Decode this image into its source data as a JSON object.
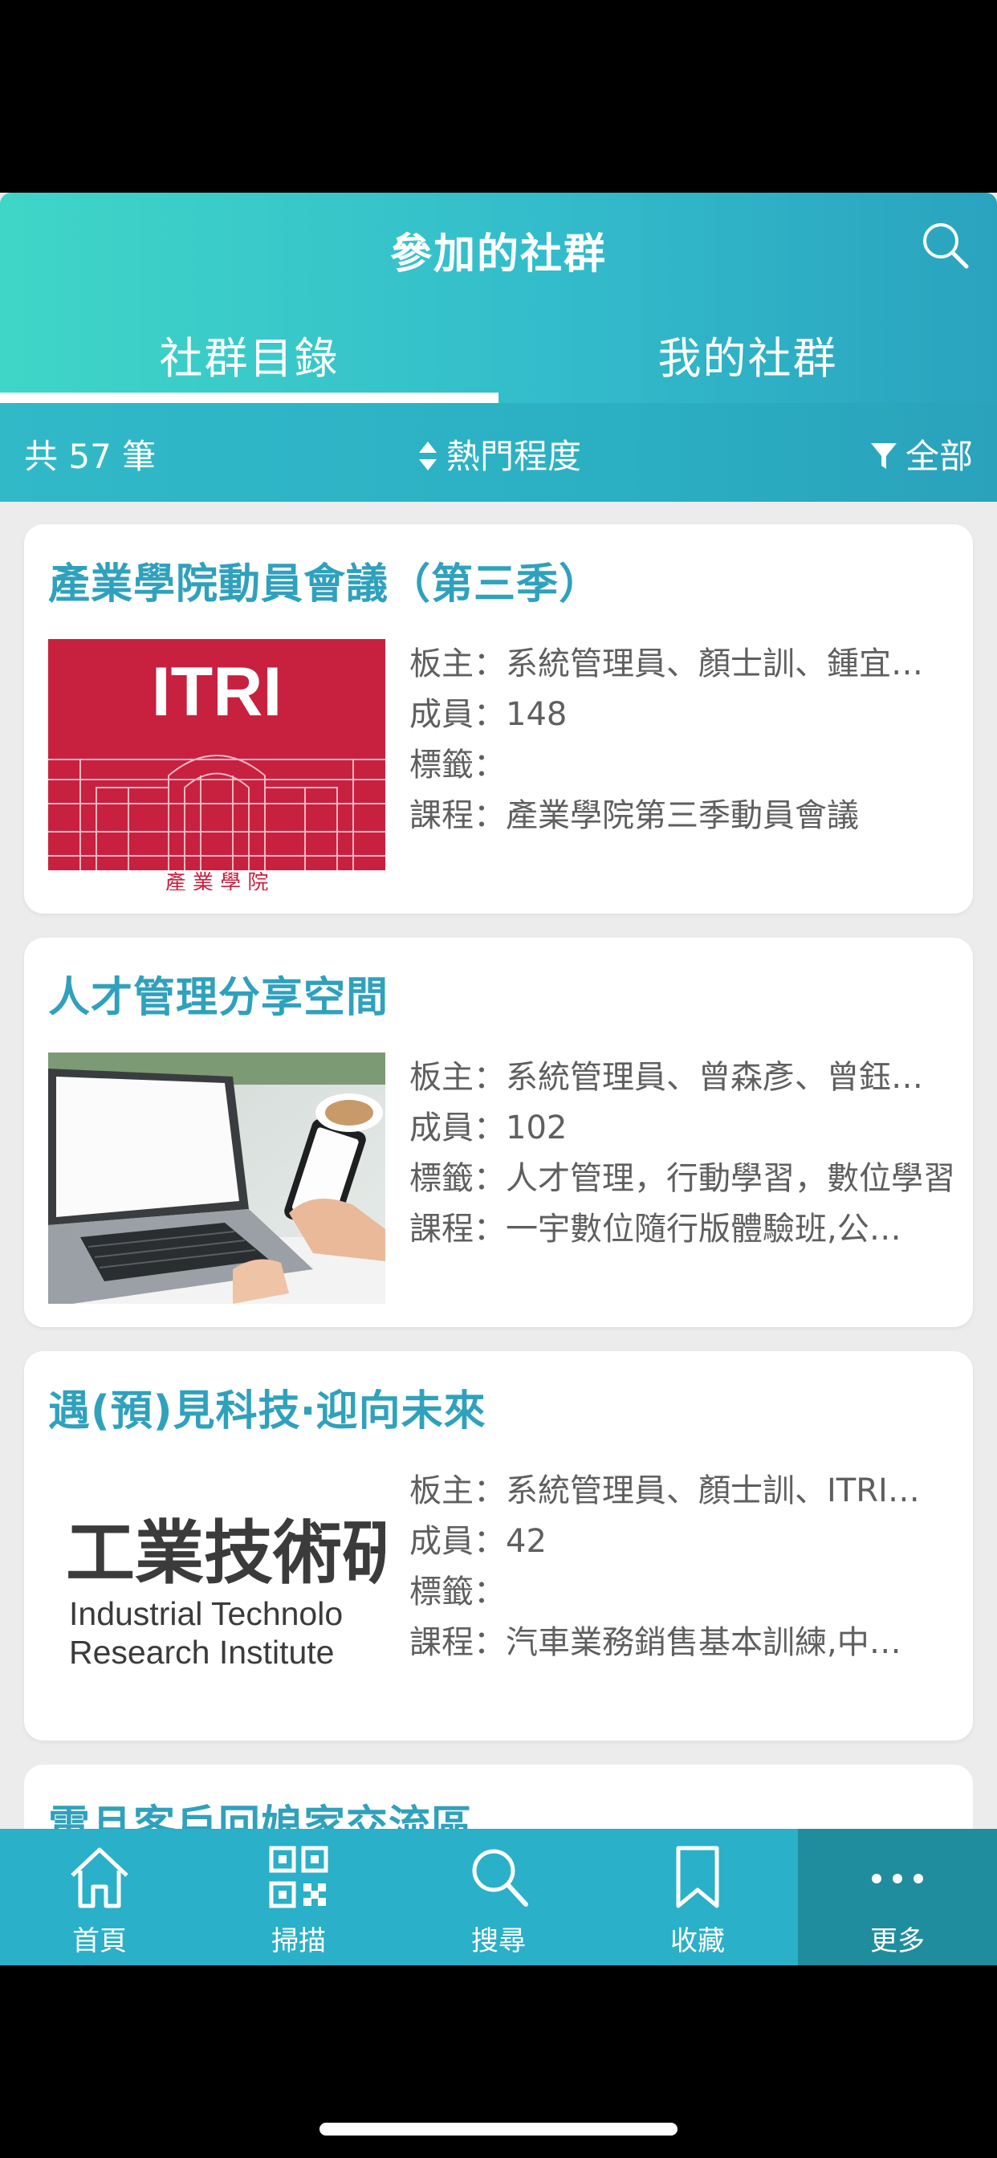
{
  "header": {
    "title": "參加的社群",
    "tabs": [
      {
        "label": "社群目錄",
        "active": true
      },
      {
        "label": "我的社群",
        "active": false
      }
    ]
  },
  "filter_bar": {
    "count_label": "共 57 筆",
    "sort_label": "熱門程度",
    "filter_label": "全部"
  },
  "field_keys": {
    "owner": "板主：",
    "members": "成員：",
    "tags": "標籤：",
    "courses": "課程："
  },
  "communities": [
    {
      "title": "產業學院動員會議（第三季）",
      "owner": "系統管理員、顏士訓、鍾宜…",
      "members": "148",
      "tags": "",
      "courses": "產業學院第三季動員會議",
      "image": {
        "type": "itri-logo",
        "text": "ITRI",
        "subtext": "產 業 學 院"
      }
    },
    {
      "title": "人才管理分享空間",
      "owner": "系統管理員、曾森彥、曾鈺…",
      "members": "102",
      "tags": "人才管理，行動學習，數位學習",
      "courses": "一宇數位隨行版體驗班,公…",
      "image": {
        "type": "laptop-photo"
      }
    },
    {
      "title": "遇(預)見科技‧迎向未來",
      "owner": "系統管理員、顏士訓、ITRI…",
      "members": "42",
      "tags": "",
      "courses": "汽車業務銷售基本訓練,中…",
      "image": {
        "type": "institute-logo",
        "line1": "工業技術研",
        "line2": "Industrial Technolo",
        "line3": "Research Institute"
      }
    },
    {
      "title": "電且客戶回娘家交流區",
      "partial": true
    }
  ],
  "tabbar": {
    "items": [
      {
        "label": "首頁",
        "icon": "home-icon"
      },
      {
        "label": "掃描",
        "icon": "qr-code-icon"
      },
      {
        "label": "搜尋",
        "icon": "search-icon"
      },
      {
        "label": "收藏",
        "icon": "bookmark-icon"
      },
      {
        "label": "更多",
        "icon": "more-icon",
        "active": true
      }
    ]
  },
  "colors": {
    "header_start": "#3fd6c7",
    "header_end": "#2aa3bf",
    "title_text": "#2fa1bd",
    "tabbar": "#2ab0c8",
    "tabbar_active": "#1f8d9e"
  }
}
